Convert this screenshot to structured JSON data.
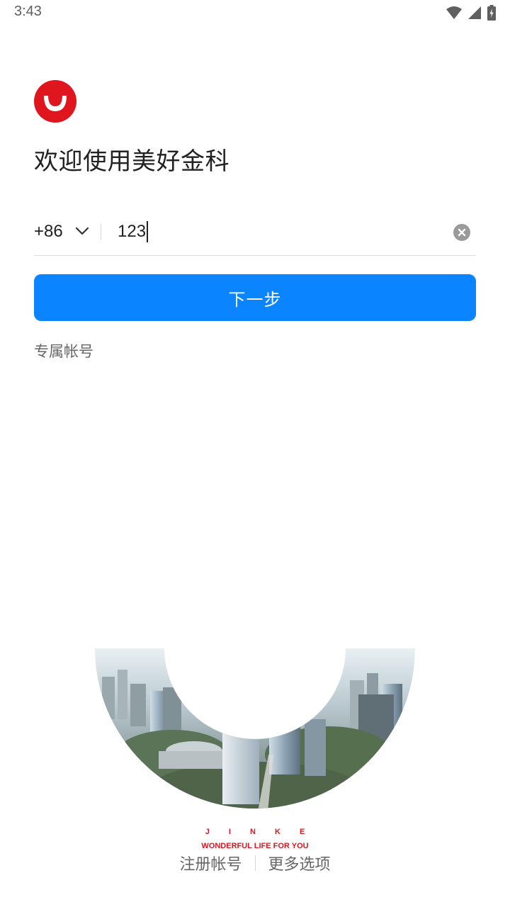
{
  "status_bar": {
    "time": "3:43",
    "icons": [
      "wifi-icon",
      "signal-icon",
      "battery-charging-icon"
    ]
  },
  "app": {
    "welcome_title": "欢迎使用美好金科"
  },
  "phone_form": {
    "country_code": "+86",
    "phone_value": "123"
  },
  "actions": {
    "next_label": "下一步",
    "dedicated_account_label": "专属帐号",
    "register_label": "注册帐号",
    "more_options_label": "更多选项"
  },
  "brand": {
    "name": "J I N K E",
    "slogan": "WONDERFUL LIFE FOR YOU"
  },
  "colors": {
    "primary": "#0a84ff",
    "brand_red": "#e0161f",
    "text_primary": "#222222",
    "text_secondary": "#666666"
  }
}
